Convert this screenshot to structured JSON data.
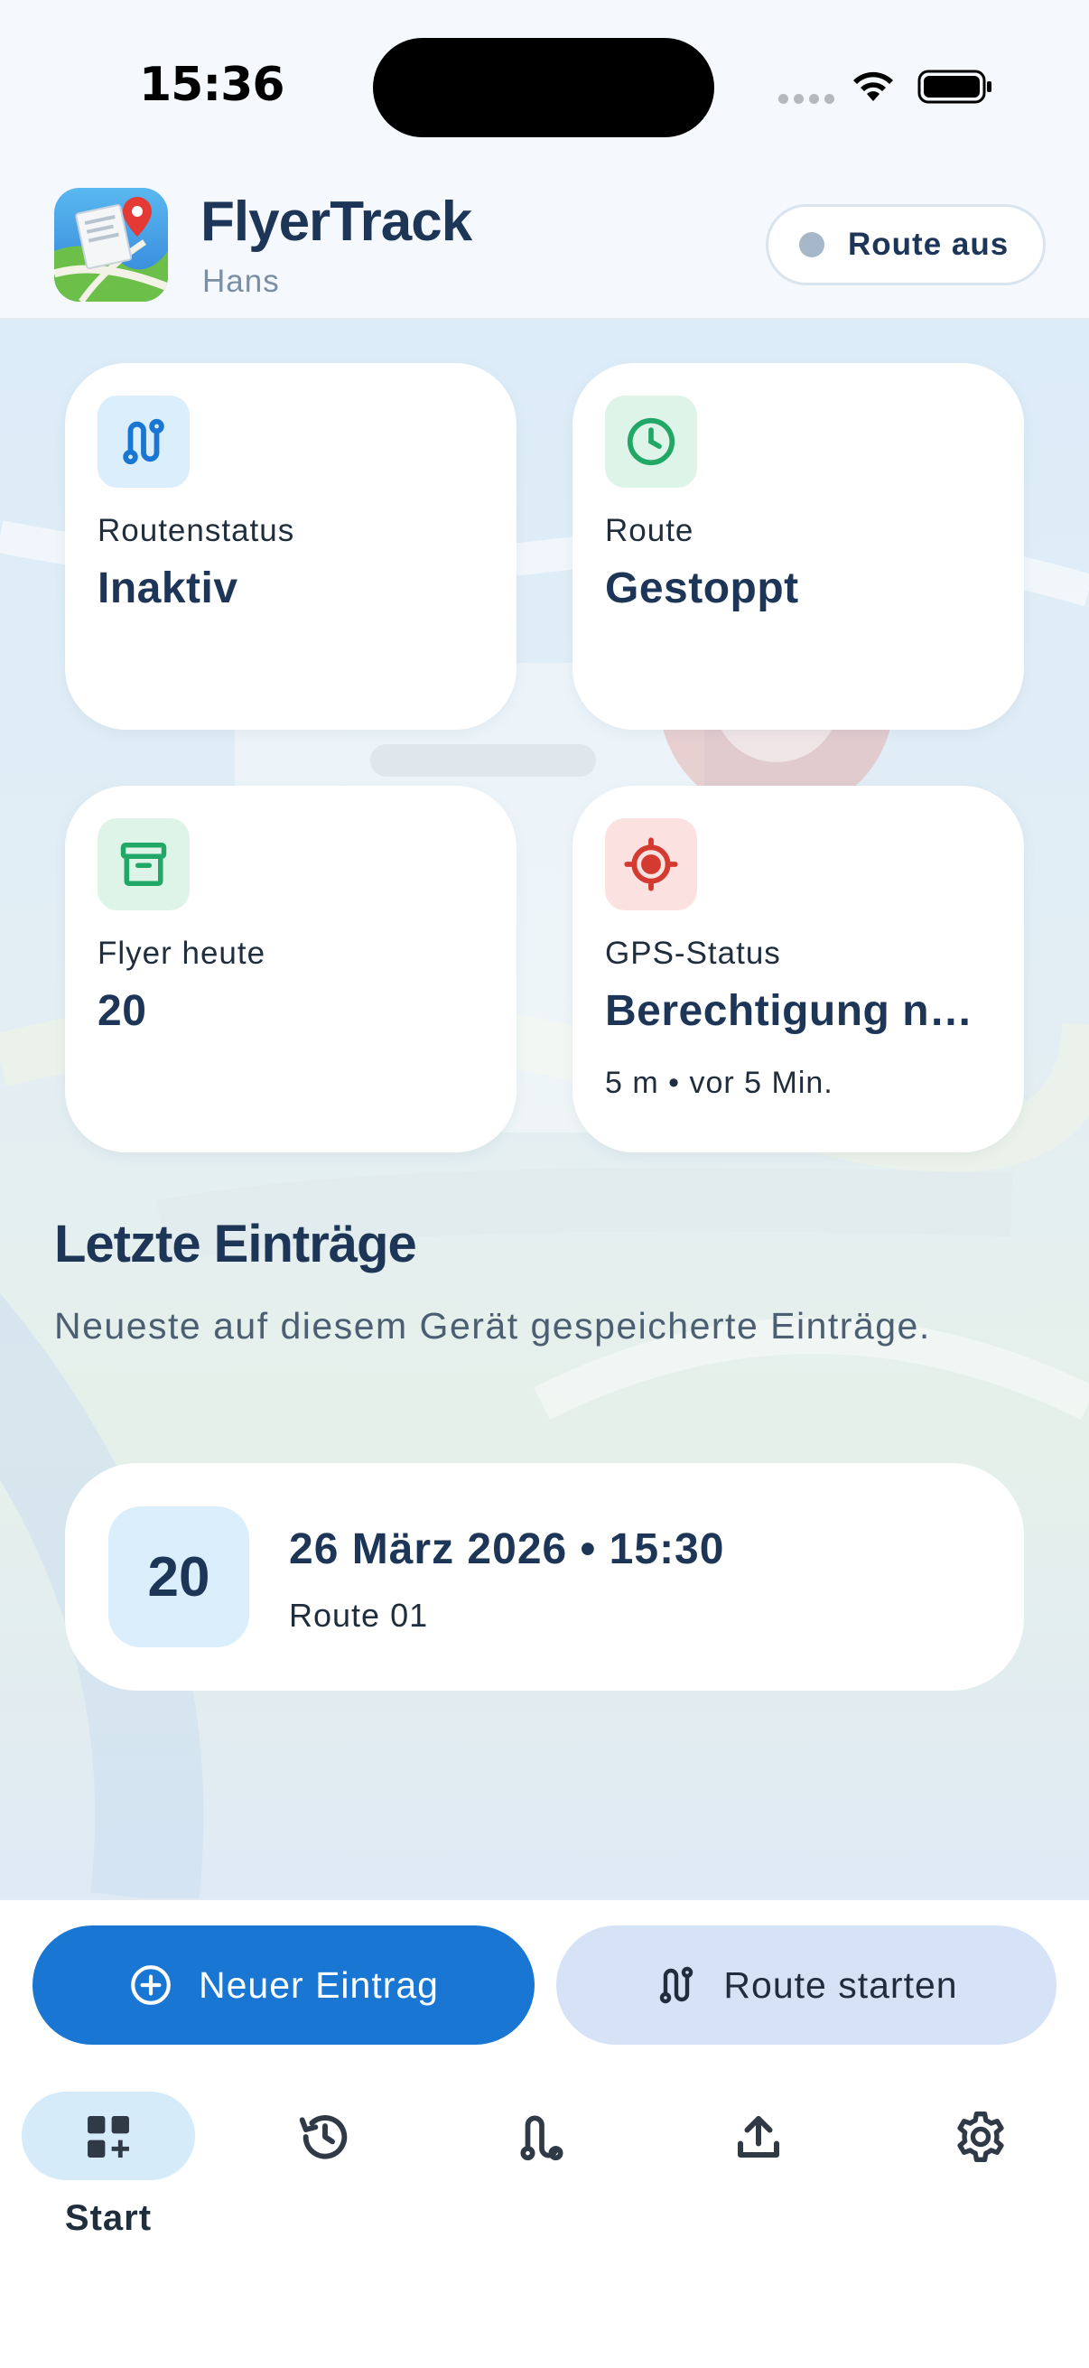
{
  "status_bar": {
    "time": "15:36"
  },
  "header": {
    "app_title": "FlyerTrack",
    "user_name": "Hans",
    "route_pill_label": "Route aus"
  },
  "cards": [
    {
      "icon": "route-icon",
      "label": "Routenstatus",
      "value": "Inaktiv",
      "sub": "",
      "icon_bg": "#dbeefb",
      "icon_color": "#1976d2"
    },
    {
      "icon": "clock-icon",
      "label": "Route",
      "value": "Gestoppt",
      "sub": "",
      "icon_bg": "#dff4e8",
      "icon_color": "#22a866"
    },
    {
      "icon": "archive-icon",
      "label": "Flyer heute",
      "value": "20",
      "sub": "",
      "icon_bg": "#dff4e8",
      "icon_color": "#22a866"
    },
    {
      "icon": "gps-target-icon",
      "label": "GPS-Status",
      "value": "Berechtigung n…",
      "sub": "5 m • vor 5 Min.",
      "icon_bg": "#fbe2e0",
      "icon_color": "#d43b30"
    }
  ],
  "recent": {
    "title": "Letzte Einträge",
    "subtitle": "Neueste auf diesem Gerät gespeicherte Einträge.",
    "entries": [
      {
        "count": "20",
        "title": "26 März 2026 • 15:30",
        "sub": "Route 01"
      }
    ]
  },
  "actions": {
    "new_entry": "Neuer Eintrag",
    "start_route": "Route starten"
  },
  "tabs": [
    {
      "icon": "dashboard-add-icon",
      "label": "Start",
      "active": true
    },
    {
      "icon": "history-icon",
      "label": "",
      "active": false
    },
    {
      "icon": "route-icon",
      "label": "",
      "active": false
    },
    {
      "icon": "upload-icon",
      "label": "",
      "active": false
    },
    {
      "icon": "gear-icon",
      "label": "",
      "active": false
    }
  ],
  "colors": {
    "primary": "#1976d2",
    "text_dark": "#1d3557",
    "green": "#22a866",
    "red": "#d43b30"
  }
}
